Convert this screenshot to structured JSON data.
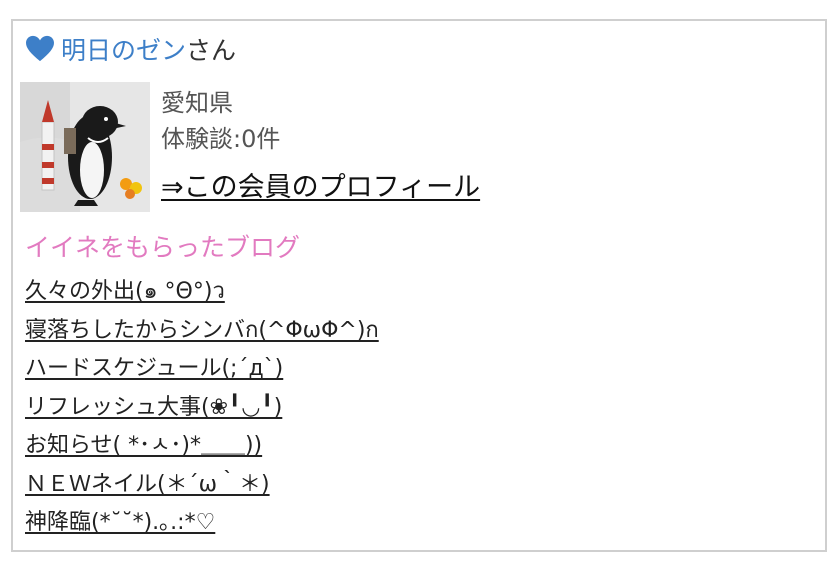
{
  "header": {
    "icon": "heart-icon",
    "icon_color": "#3d7fc8",
    "member_name": "明日のゼン",
    "honorific": "さん"
  },
  "profile": {
    "avatar": "penguin-plush-photo",
    "prefecture": "愛知県",
    "experience_count": "体験談:0件",
    "profile_link": "⇒この会員のプロフィール"
  },
  "liked_blogs": {
    "title": "イイネをもらったブログ",
    "title_color": "#e27ac0",
    "items": [
      "久々の外出(๑ °Θ°)ว",
      "寝落ちしたからシンバก(^ΦωΦ^)ก",
      "ハードスケジュール(;´д`)",
      "リフレッシュ大事(❀╹◡╹)",
      "お知らせ( *･ㅅ･)*＿＿))",
      "ＮＥＷネイル(＊´ω｀＊)",
      "神降臨(*˘˘*).｡.:*♡"
    ]
  }
}
